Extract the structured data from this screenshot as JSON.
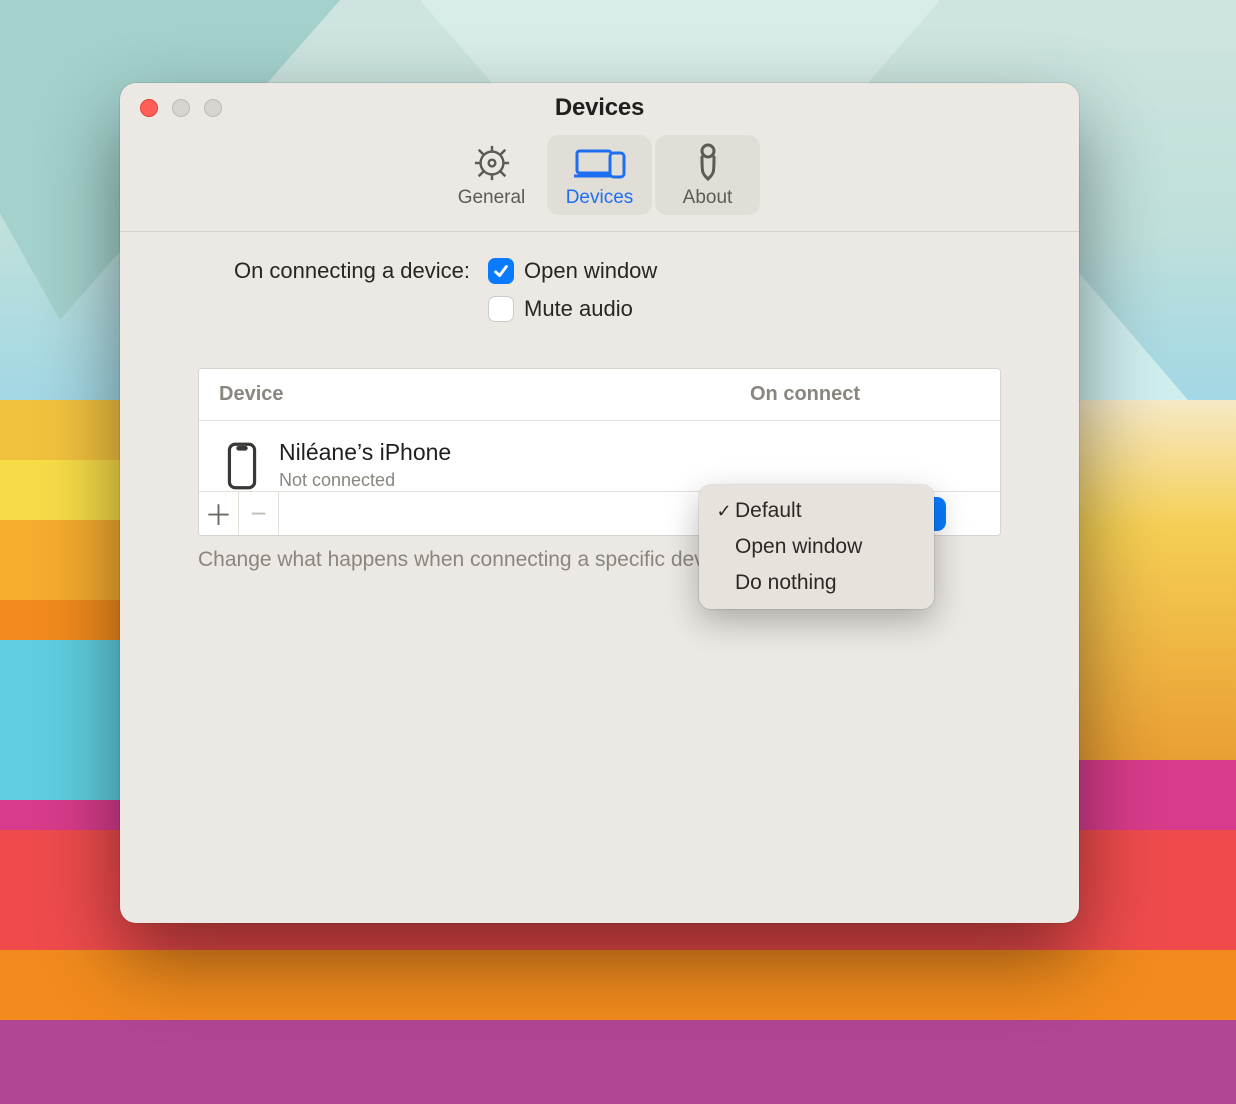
{
  "title": "Devices",
  "toolbar": {
    "general": "General",
    "devices": "Devices",
    "about": "About"
  },
  "onConnect": {
    "label": "On connecting a device:",
    "openWindow": {
      "label": "Open window",
      "checked": true
    },
    "muteAudio": {
      "label": "Mute audio",
      "checked": false
    }
  },
  "table": {
    "columns": {
      "device": "Device",
      "action": "On connect"
    },
    "rows": [
      {
        "name": "Niléane’s iPhone",
        "status": "Not connected"
      }
    ]
  },
  "menu": {
    "options": [
      "Default",
      "Open window",
      "Do nothing"
    ],
    "selectedIndex": 0
  },
  "hint": "Change what happens when connecting a specific device."
}
